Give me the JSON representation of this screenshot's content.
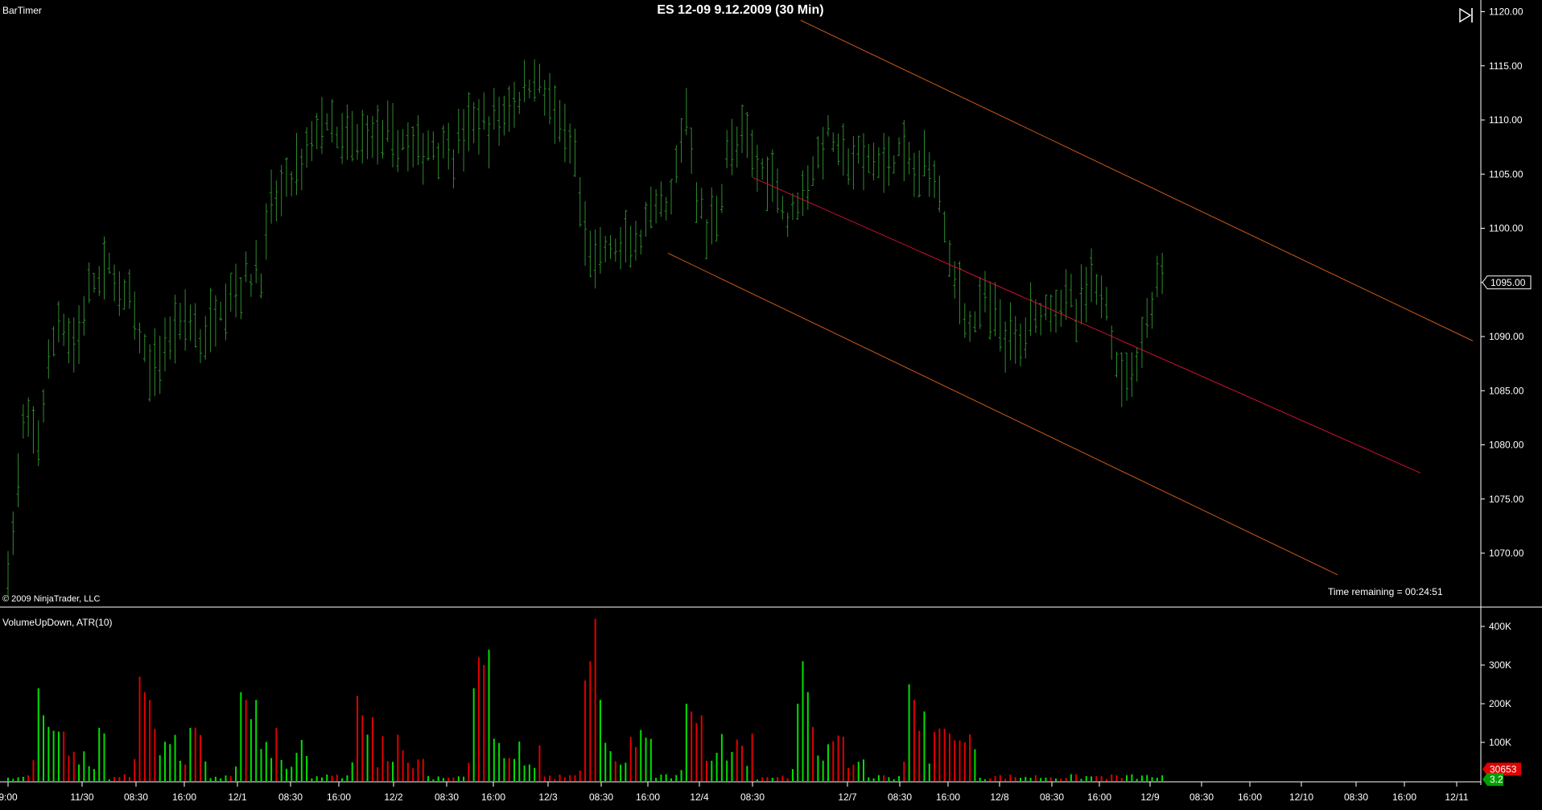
{
  "header": {
    "indicator_label": "BarTimer",
    "title": "ES 12-09 9.12.2009 (30 Min)",
    "copyright": "© 2009 NinjaTrader, LLC",
    "timer": "Time remaining = 00:24:51"
  },
  "volume_panel": {
    "label": "VolumeUpDown, ATR(10)"
  },
  "colors": {
    "background": "#000000",
    "price_bars": "#2e8b2e",
    "volume_up": "#00e000",
    "volume_down": "#e00000",
    "channel_outer": "#cc5a1a",
    "channel_mid": "#d01030",
    "axis": "#ffffff",
    "last_price_box": "#ffffff",
    "volume_last_box": "#e00000",
    "atr_box": "#00a000"
  },
  "icons": {
    "collapse": "panel-collapse-icon"
  },
  "chart_data": [
    {
      "type": "ohlc",
      "title": "ES 12-09 9.12.2009 (30 Min)",
      "price_axis": {
        "ticks": [
          1070,
          1075,
          1080,
          1085,
          1090,
          1095,
          1100,
          1105,
          1110,
          1115,
          1120
        ],
        "ylim": [
          1066,
          1121
        ],
        "last_price": "1095.00"
      },
      "x_axis_labels": [
        "9:00",
        "11/30",
        "08:30",
        "16:00",
        "12/1",
        "08:30",
        "16:00",
        "12/2",
        "08:30",
        "16:00",
        "12/3",
        "08:30",
        "16:00",
        "12/4",
        "08:30",
        "12/7",
        "08:30",
        "16:00",
        "12/8",
        "08:30",
        "16:00",
        "12/9",
        "08:30",
        "16:00",
        "12/10",
        "08:30",
        "16:00",
        "12/11"
      ],
      "close_path": [
        [
          0,
          1068
        ],
        [
          3,
          1081
        ],
        [
          6,
          1081
        ],
        [
          10,
          1092
        ],
        [
          13,
          1089
        ],
        [
          17,
          1095
        ],
        [
          20,
          1096
        ],
        [
          24,
          1093
        ],
        [
          27,
          1088
        ],
        [
          29,
          1087
        ],
        [
          33,
          1091
        ],
        [
          36,
          1092
        ],
        [
          38,
          1089
        ],
        [
          42,
          1093
        ],
        [
          46,
          1095
        ],
        [
          50,
          1096
        ],
        [
          52,
          1102
        ],
        [
          55,
          1104
        ],
        [
          58,
          1106
        ],
        [
          62,
          1110
        ],
        [
          65,
          1108
        ],
        [
          68,
          1108
        ],
        [
          72,
          1109
        ],
        [
          75,
          1108
        ],
        [
          78,
          1108
        ],
        [
          82,
          1107
        ],
        [
          85,
          1108
        ],
        [
          88,
          1107
        ],
        [
          92,
          1110
        ],
        [
          95,
          1109
        ],
        [
          98,
          1111
        ],
        [
          101,
          1112
        ],
        [
          104,
          1114
        ],
        [
          107,
          1112
        ],
        [
          109,
          1109
        ],
        [
          112,
          1106
        ],
        [
          114,
          1099
        ],
        [
          116,
          1097
        ],
        [
          119,
          1098
        ],
        [
          122,
          1098
        ],
        [
          125,
          1099
        ],
        [
          128,
          1101
        ],
        [
          131,
          1102
        ],
        [
          134,
          1111
        ],
        [
          136,
          1103
        ],
        [
          138,
          1100
        ],
        [
          140,
          1101
        ],
        [
          142,
          1107
        ],
        [
          145,
          1108
        ],
        [
          148,
          1106
        ],
        [
          151,
          1105
        ],
        [
          154,
          1101
        ],
        [
          157,
          1104
        ],
        [
          160,
          1106
        ],
        [
          162,
          1109
        ],
        [
          164,
          1107
        ],
        [
          167,
          1106
        ],
        [
          170,
          1106
        ],
        [
          173,
          1106
        ],
        [
          176,
          1107
        ],
        [
          179,
          1105
        ],
        [
          182,
          1106
        ],
        [
          184,
          1104
        ],
        [
          186,
          1097
        ],
        [
          188,
          1094
        ],
        [
          190,
          1091
        ],
        [
          193,
          1093
        ],
        [
          196,
          1091
        ],
        [
          199,
          1089
        ],
        [
          202,
          1092
        ],
        [
          205,
          1093
        ],
        [
          208,
          1094
        ],
        [
          211,
          1092
        ],
        [
          214,
          1095
        ],
        [
          217,
          1093
        ],
        [
          220,
          1086
        ],
        [
          222,
          1087
        ],
        [
          224,
          1090
        ],
        [
          226,
          1093
        ],
        [
          228,
          1096
        ]
      ],
      "channel": {
        "upper": {
          "from": [
            "12/4 16:00",
            1119.2
          ],
          "to": [
            "12/10 16:00",
            1089.6
          ]
        },
        "middle": {
          "from": [
            "12/4 08:30",
            1104.7
          ],
          "to": [
            "12/10 16:00",
            1077.4
          ]
        },
        "lower": {
          "from": [
            "12/3 16:00",
            1097.7
          ],
          "to": [
            "12/10 08:30",
            1068.0
          ]
        }
      }
    },
    {
      "type": "bar",
      "title": "VolumeUpDown, ATR(10)",
      "y_axis": {
        "ticks": [
          "100K",
          "200K",
          "300K",
          "400K"
        ],
        "ylim": [
          0,
          430000
        ]
      },
      "spikes": [
        {
          "bar": 6,
          "values": [
            240000,
            170000,
            140000,
            130000
          ]
        },
        {
          "bar": 26,
          "values": [
            270000,
            230000,
            210000,
            135000
          ]
        },
        {
          "bar": 46,
          "values": [
            230000,
            210000,
            160000,
            210000
          ]
        },
        {
          "bar": 69,
          "values": [
            220000,
            170000,
            120000,
            165000
          ]
        },
        {
          "bar": 92,
          "values": [
            240000,
            320000,
            300000,
            340000
          ]
        },
        {
          "bar": 114,
          "values": [
            260000,
            310000,
            420000,
            210000
          ]
        },
        {
          "bar": 134,
          "values": [
            200000,
            180000,
            150000,
            170000
          ]
        },
        {
          "bar": 156,
          "values": [
            200000,
            310000,
            230000,
            140000
          ]
        },
        {
          "bar": 178,
          "values": [
            250000,
            210000,
            130000,
            180000
          ]
        }
      ],
      "last_volume": "30653",
      "atr_value": "3.2"
    }
  ]
}
